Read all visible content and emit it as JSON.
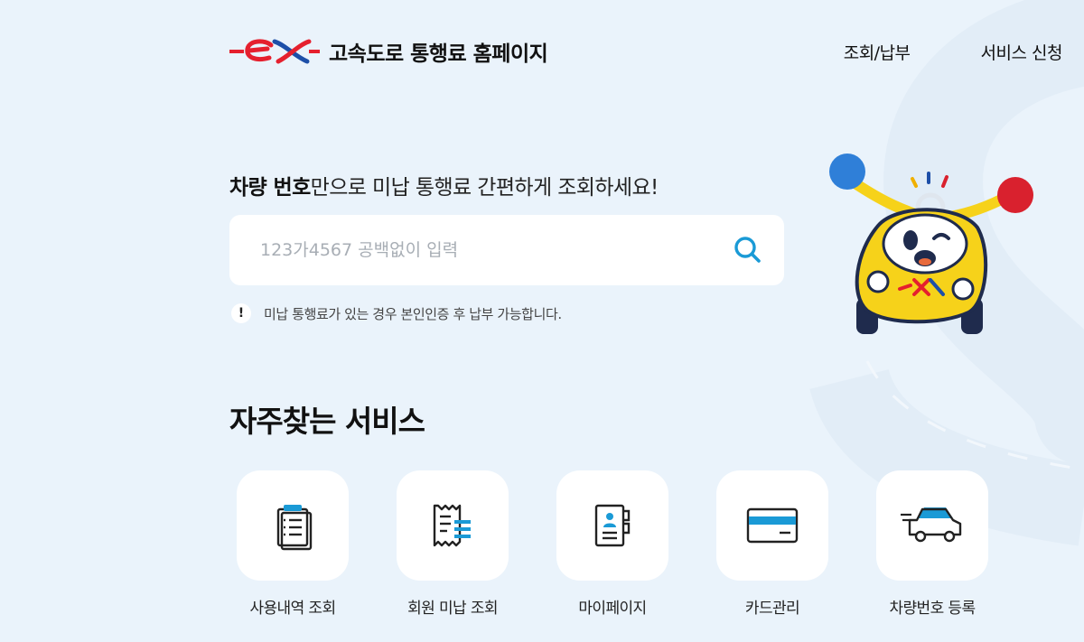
{
  "header": {
    "site_title": "고속도로 통행료 홈페이지",
    "nav": [
      {
        "label": "조회/납부"
      },
      {
        "label": "서비스 신청"
      }
    ]
  },
  "hero": {
    "heading_bold": "차량 번호",
    "heading_rest": "만으로 미납 통행료 간편하게 조회하세요!",
    "search": {
      "placeholder": "123가4567 공백없이 입력",
      "value": ""
    },
    "notice": {
      "icon": "!",
      "text": "미납 통행료가 있는 경우 본인인증 후 납부 가능합니다."
    }
  },
  "services": {
    "title": "자주찾는 서비스",
    "items": [
      {
        "label": "사용내역 조회",
        "icon": "clipboard-list-icon"
      },
      {
        "label": "회원 미납 조회",
        "icon": "receipt-icon"
      },
      {
        "label": "마이페이지",
        "icon": "profile-book-icon"
      },
      {
        "label": "카드관리",
        "icon": "credit-card-icon"
      },
      {
        "label": "차량번호 등록",
        "icon": "car-icon"
      }
    ]
  },
  "colors": {
    "background": "#eaf3fb",
    "accent_blue": "#1a9ad6",
    "brand_red": "#e5202e",
    "brand_blue": "#1d4fa8",
    "mascot_yellow": "#f6d21a"
  }
}
